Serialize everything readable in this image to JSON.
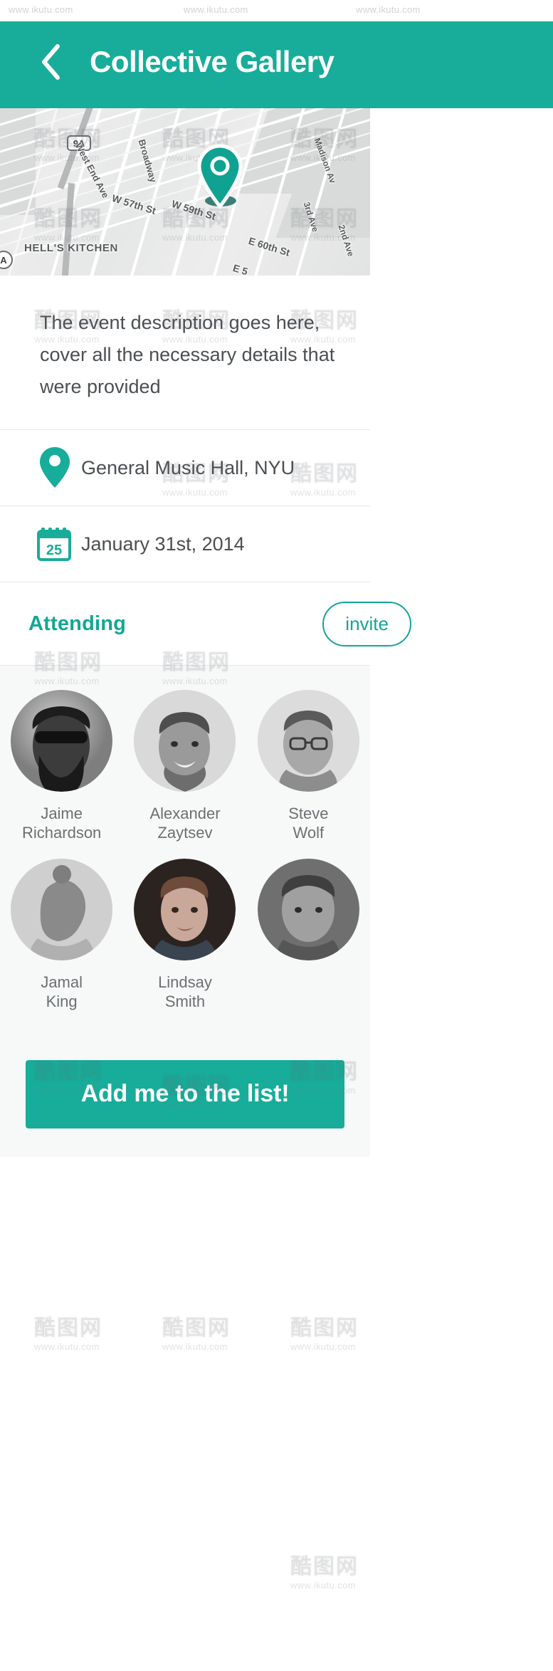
{
  "header": {
    "title": "Collective Gallery",
    "back_icon": "chevron-left-icon",
    "bg_color": "#17ad9a"
  },
  "watermarks": {
    "url": "www.ikutu.com",
    "logo": "酷图网"
  },
  "map": {
    "labels": [
      {
        "text": "9A",
        "type": "shield"
      },
      {
        "text": "West End Ave",
        "type": "street"
      },
      {
        "text": "Broadway",
        "type": "street"
      },
      {
        "text": "Madison Av",
        "type": "street"
      },
      {
        "text": "3rd Ave",
        "type": "street"
      },
      {
        "text": "2nd Ave",
        "type": "street"
      },
      {
        "text": "W 57th St",
        "type": "street"
      },
      {
        "text": "W 59th St",
        "type": "street"
      },
      {
        "text": "E 60th St",
        "type": "street"
      },
      {
        "text": "E 5",
        "type": "street"
      },
      {
        "text": "HELL'S KITCHEN",
        "type": "neighborhood"
      },
      {
        "text": "A",
        "type": "shield-round"
      }
    ],
    "pin_color": "#0fa292",
    "marker_name": "map-location-pin"
  },
  "event": {
    "description_lines": [
      "The event description goes here,",
      "cover all the necessary details that",
      "were provided"
    ],
    "location": {
      "icon": "location-pin-icon",
      "text": "General Music Hall, NYU"
    },
    "date": {
      "icon": "calendar-icon",
      "icon_day": "25",
      "text": "January 31st, 2014"
    }
  },
  "attending": {
    "label": "Attending",
    "invite_label": "invite",
    "people": [
      {
        "name_line1": "Jaime",
        "name_line2": "Richardson",
        "avatar": "avatar-bearded-sunglasses"
      },
      {
        "name_line1": "Alexander",
        "name_line2": "Zaytsev",
        "avatar": "avatar-smiling-man"
      },
      {
        "name_line1": "Steve",
        "name_line2": "Wolf",
        "avatar": "avatar-glasses-plaid"
      },
      {
        "name_line1": "Jamal",
        "name_line2": "King",
        "avatar": "avatar-bun-beard"
      },
      {
        "name_line1": "Lindsay",
        "name_line2": "Smith",
        "avatar": "avatar-young-man"
      },
      {
        "name_line1": "",
        "name_line2": "",
        "avatar": "avatar-obscured"
      }
    ]
  },
  "cta": {
    "label": "Add me to the list!",
    "color": "#17ad9a"
  },
  "colors": {
    "accent": "#17ad9a",
    "accent_text": "#12a795",
    "body_text": "#4b4f52",
    "muted_text": "#6c7073",
    "panel_bg": "#f7f8f8"
  }
}
